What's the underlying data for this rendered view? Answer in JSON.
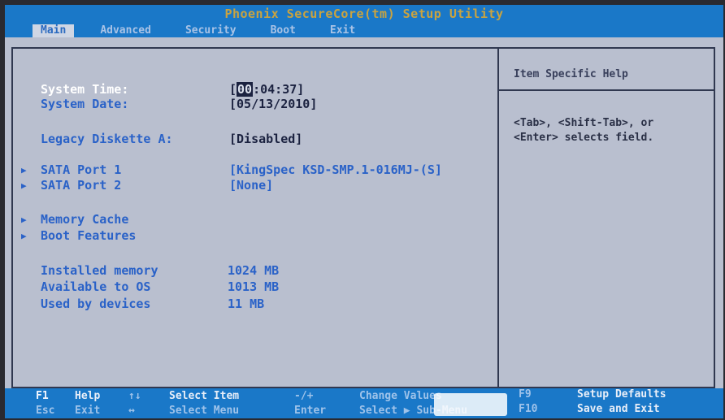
{
  "app_title": "Phoenix SecureCore(tm) Setup Utility",
  "menu": [
    {
      "label": "Main",
      "active": true
    },
    {
      "label": "Advanced",
      "active": false
    },
    {
      "label": "Security",
      "active": false
    },
    {
      "label": "Boot",
      "active": false
    },
    {
      "label": "Exit",
      "active": false
    }
  ],
  "time": {
    "label": "System Time:",
    "hour": "00",
    "rest": ":04:37]",
    "open": "["
  },
  "date": {
    "label": "System Date:",
    "value": "[05/13/2010]"
  },
  "diskette": {
    "label": "Legacy Diskette A:",
    "value": "[Disabled]"
  },
  "sata1": {
    "label": "SATA Port 1",
    "value": "[KingSpec KSD-SMP.1-016MJ-(S]"
  },
  "sata2": {
    "label": "SATA Port 2",
    "value": "[None]"
  },
  "submenus": {
    "memory_cache": "Memory Cache",
    "boot_features": "Boot Features"
  },
  "memory": {
    "installed_label": "Installed memory",
    "installed_value": "1024 MB",
    "available_label": "Available to OS",
    "available_value": "1013 MB",
    "used_label": "Used by devices",
    "used_value": "11 MB"
  },
  "help": {
    "title": "Item Specific Help",
    "line1": "<Tab>, <Shift-Tab>, or",
    "line2": "<Enter> selects field."
  },
  "status": {
    "f1": "F1",
    "help": "Help",
    "arrows_ud": "↑↓",
    "select_item": "Select Item",
    "plusminus": "-/+",
    "change_values": "Change Values",
    "f9": "F9",
    "setup_defaults": "Setup Defaults",
    "esc": "Esc",
    "exit": "Exit",
    "arrows_lr": "↔",
    "select_menu": "Select Menu",
    "enter": "Enter",
    "select_sub": "Select ▶ Sub-Menu",
    "f10": "F10",
    "save_exit": "Save and Exit"
  },
  "colors": {
    "bios_blue": "#1a78c8",
    "panel_gray": "#b9bfcf",
    "item_blue": "#2a62c8"
  }
}
